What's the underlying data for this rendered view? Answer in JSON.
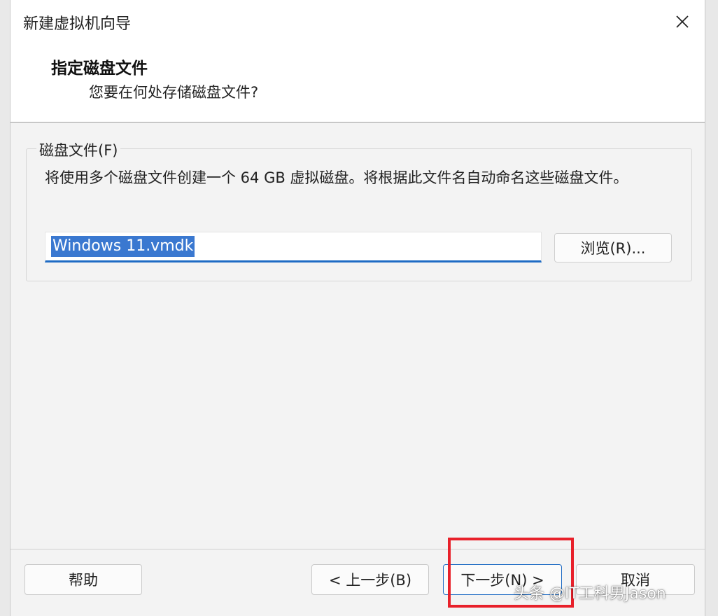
{
  "window": {
    "title": "新建虚拟机向导",
    "close_icon": "close-icon"
  },
  "header": {
    "title": "指定磁盘文件",
    "subtitle": "您要在何处存储磁盘文件?"
  },
  "disk_group": {
    "legend": "磁盘文件(F)",
    "description": "将使用多个磁盘文件创建一个 64 GB 虚拟磁盘。将根据此文件名自动命名这些磁盘文件。",
    "file_value": "Windows 11.vmdk",
    "browse_label": "浏览(R)..."
  },
  "footer": {
    "help_label": "帮助",
    "back_label": "< 上一步(B)",
    "next_label": "下一步(N) >",
    "cancel_label": "取消"
  },
  "watermark": {
    "text": "头条 @IT工科男Jason"
  },
  "colors": {
    "accent": "#1e6bc4",
    "highlight": "#e8202a"
  }
}
